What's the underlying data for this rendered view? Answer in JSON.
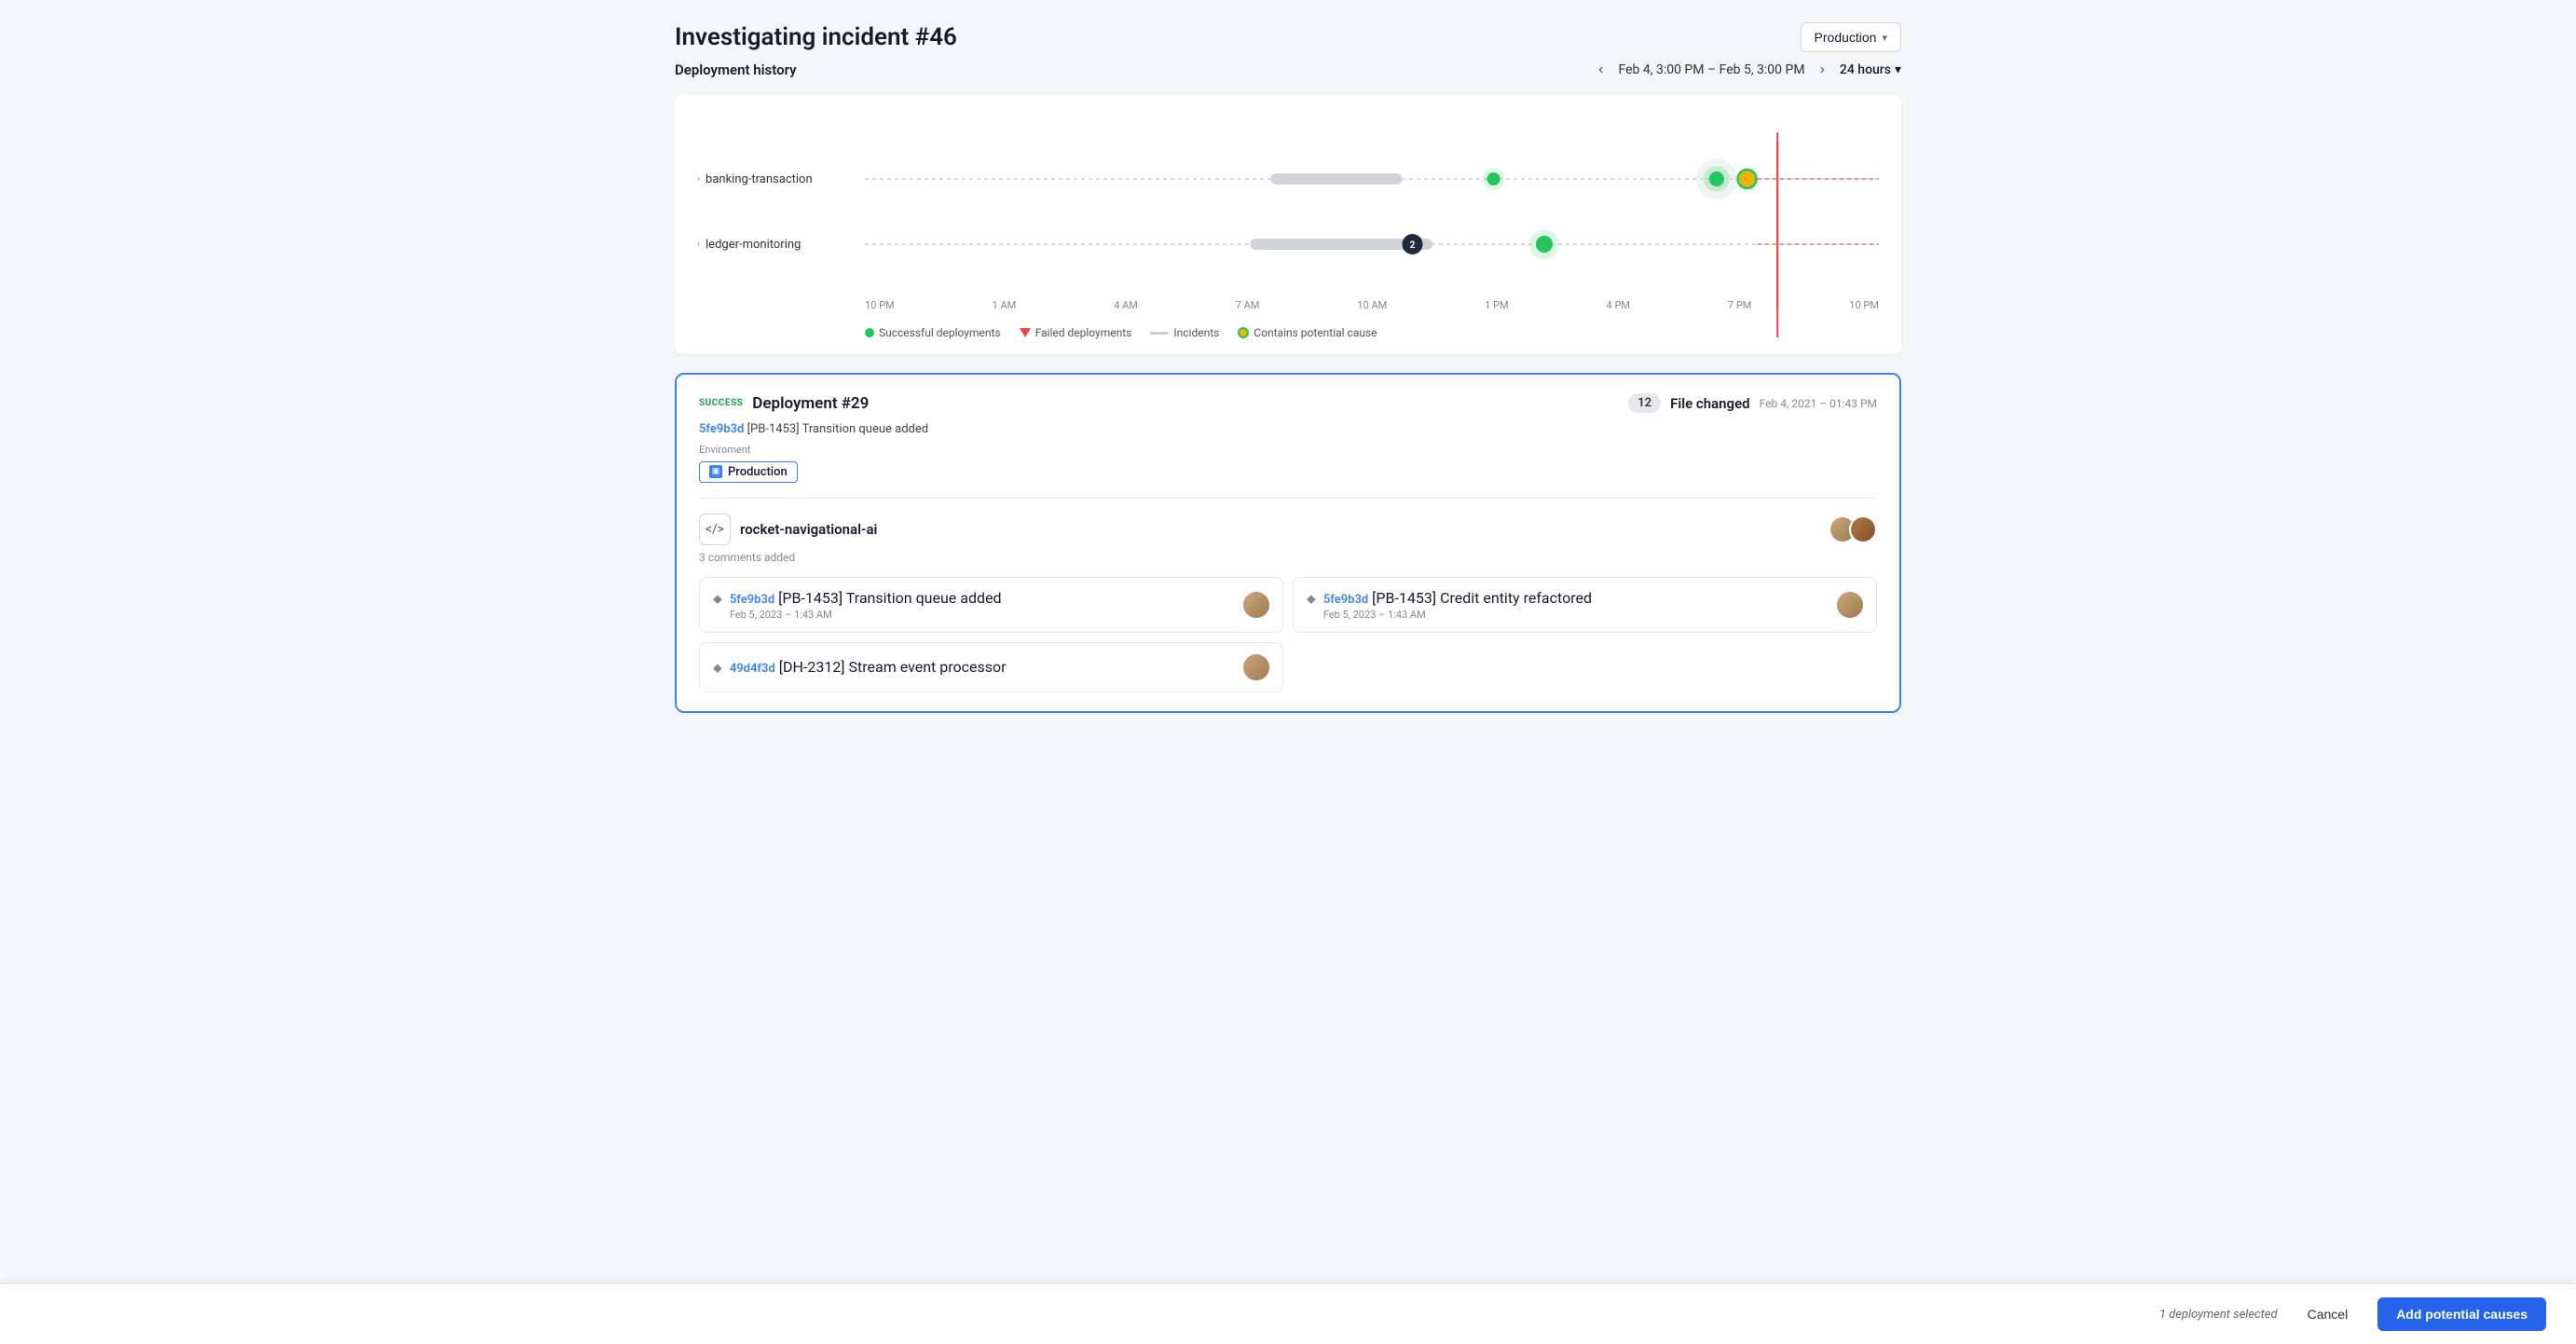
{
  "header": {
    "title": "Investigating incident #46",
    "env_dropdown_label": "Production",
    "env_dropdown_chevron": "▾"
  },
  "chart": {
    "section_label": "Deployment history",
    "time_range": "Feb 4, 3:00 PM – Feb 5, 3:00 PM",
    "hours_label": "24 hours",
    "hours_chevron": "▾",
    "time_labels": [
      "10 PM",
      "1 AM",
      "4 AM",
      "7 AM",
      "10 AM",
      "1 PM",
      "4 PM",
      "7 PM",
      "10 PM"
    ],
    "services": [
      {
        "name": "banking-transaction"
      },
      {
        "name": "ledger-monitoring"
      }
    ],
    "legend": {
      "successful": "Successful deployments",
      "failed": "Failed deployments",
      "incidents": "Incidents",
      "cause": "Contains potential cause"
    }
  },
  "deployment_card": {
    "status": "SUCCESS",
    "title": "Deployment #29",
    "commit_line": "5fe9b3d [PB-1453] Transition queue added",
    "commit_hash": "5fe9b3d",
    "commit_rest": " [PB-1453] Transition queue added",
    "env_label": "Enviroment",
    "env_name": "Production",
    "file_count": "12",
    "file_changed_label": "File changed",
    "file_date": "Feb 4, 2021 – 01:43 PM",
    "repo": {
      "name": "rocket-navigational-ai",
      "comments": "3 comments added"
    },
    "commits": [
      {
        "hash": "5fe9b3d",
        "message": "[PB-1453] Transition queue added",
        "date": "Feb 5, 2023 – 1:43 AM"
      },
      {
        "hash": "5fe9b3d",
        "message": "[PB-1453] Credit entity refactored",
        "date": "Feb 5, 2023 – 1:43 AM"
      },
      {
        "hash": "49d4f3d",
        "message": "[DH-2312] Stream event processor",
        "date": ""
      }
    ]
  },
  "bottom_bar": {
    "selected_text": "1 deployment selected",
    "cancel_label": "Cancel",
    "add_causes_label": "Add potential causes"
  }
}
